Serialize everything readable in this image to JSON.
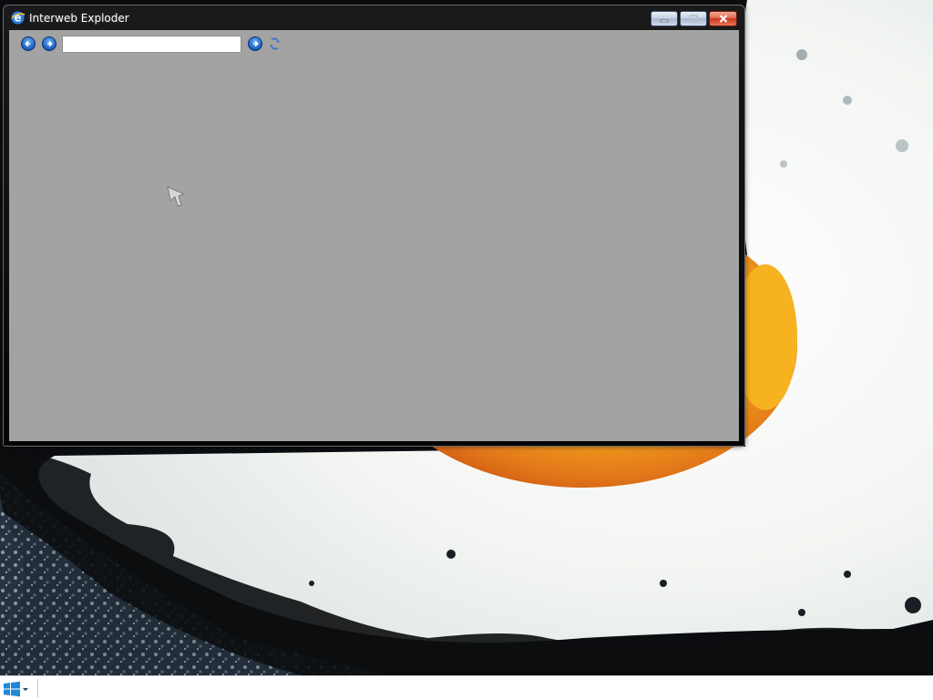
{
  "window": {
    "title": "Interweb Exploder",
    "app_icon": "browser-e-icon",
    "controls": [
      "minimize-icon",
      "maximize-icon",
      "close-icon"
    ]
  },
  "toolbar": {
    "back_icon": "back-arrow-icon",
    "forward_icon": "forward-arrow-icon",
    "address": {
      "value": "",
      "placeholder": ""
    },
    "go_icon": "go-arrow-icon",
    "refresh_icon": "refresh-icon"
  },
  "content": {
    "background": "#a3a3a3",
    "cursor_icon": "mouse-cursor-icon"
  },
  "taskbar": {
    "start_icon": "windows-logo-icon",
    "start_menu_icon": "chevron-down-icon"
  },
  "colors": {
    "title_bar": "#0a0a0a",
    "close_button": "#d0452a",
    "caption_button": "#c7d2e2",
    "nav_button": "#1d62c0",
    "taskbar": "#ffffff",
    "wallpaper_egg_yolk": "#f1a214"
  }
}
